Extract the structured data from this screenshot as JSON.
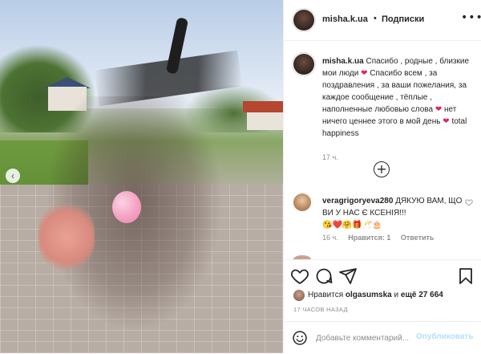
{
  "post": {
    "username": "misha.k.ua",
    "separator": "•",
    "follow_label": "Подписки",
    "more_label": "•••"
  },
  "caption": {
    "username": "misha.k.ua",
    "text_1": "Спасибо , родные , близкие мои люди",
    "text_2": "Спасибо всем , за поздравления , за ваши пожелания, за каждое сообщение , тёплые , наполненные любовью слова",
    "text_3": "нет ничего ценнее этого в мой день",
    "text_4": "total happiness",
    "time": "17 ч."
  },
  "load_more_label": "+",
  "comment": {
    "username": "veragrigoryeva280",
    "text": "ДЯКУЮ ВАМ, ЩО ВИ У НАС Є КСЕНІЯ!!!",
    "emojis": "😘❤️🤗🎁🥂🎂",
    "time": "16 ч.",
    "likes": "Нравится: 1",
    "reply": "Ответить"
  },
  "likes": {
    "prefix": "Нравится",
    "user": "olgasumska",
    "middle": "и",
    "others": "ещё 27 664"
  },
  "posted_ago": "17 ЧАСОВ НАЗАД",
  "add_comment": {
    "placeholder": "Добавьте комментарий...",
    "publish": "Опубликовать"
  },
  "colors": {
    "heart": "#e0245e",
    "publish_disabled": "#b2dffc",
    "muted": "#8e8e8e"
  },
  "icons": [
    "heart-icon",
    "comment-icon",
    "share-icon",
    "bookmark-icon",
    "emoji-icon",
    "chevron-left-icon",
    "plus-circle-icon"
  ]
}
